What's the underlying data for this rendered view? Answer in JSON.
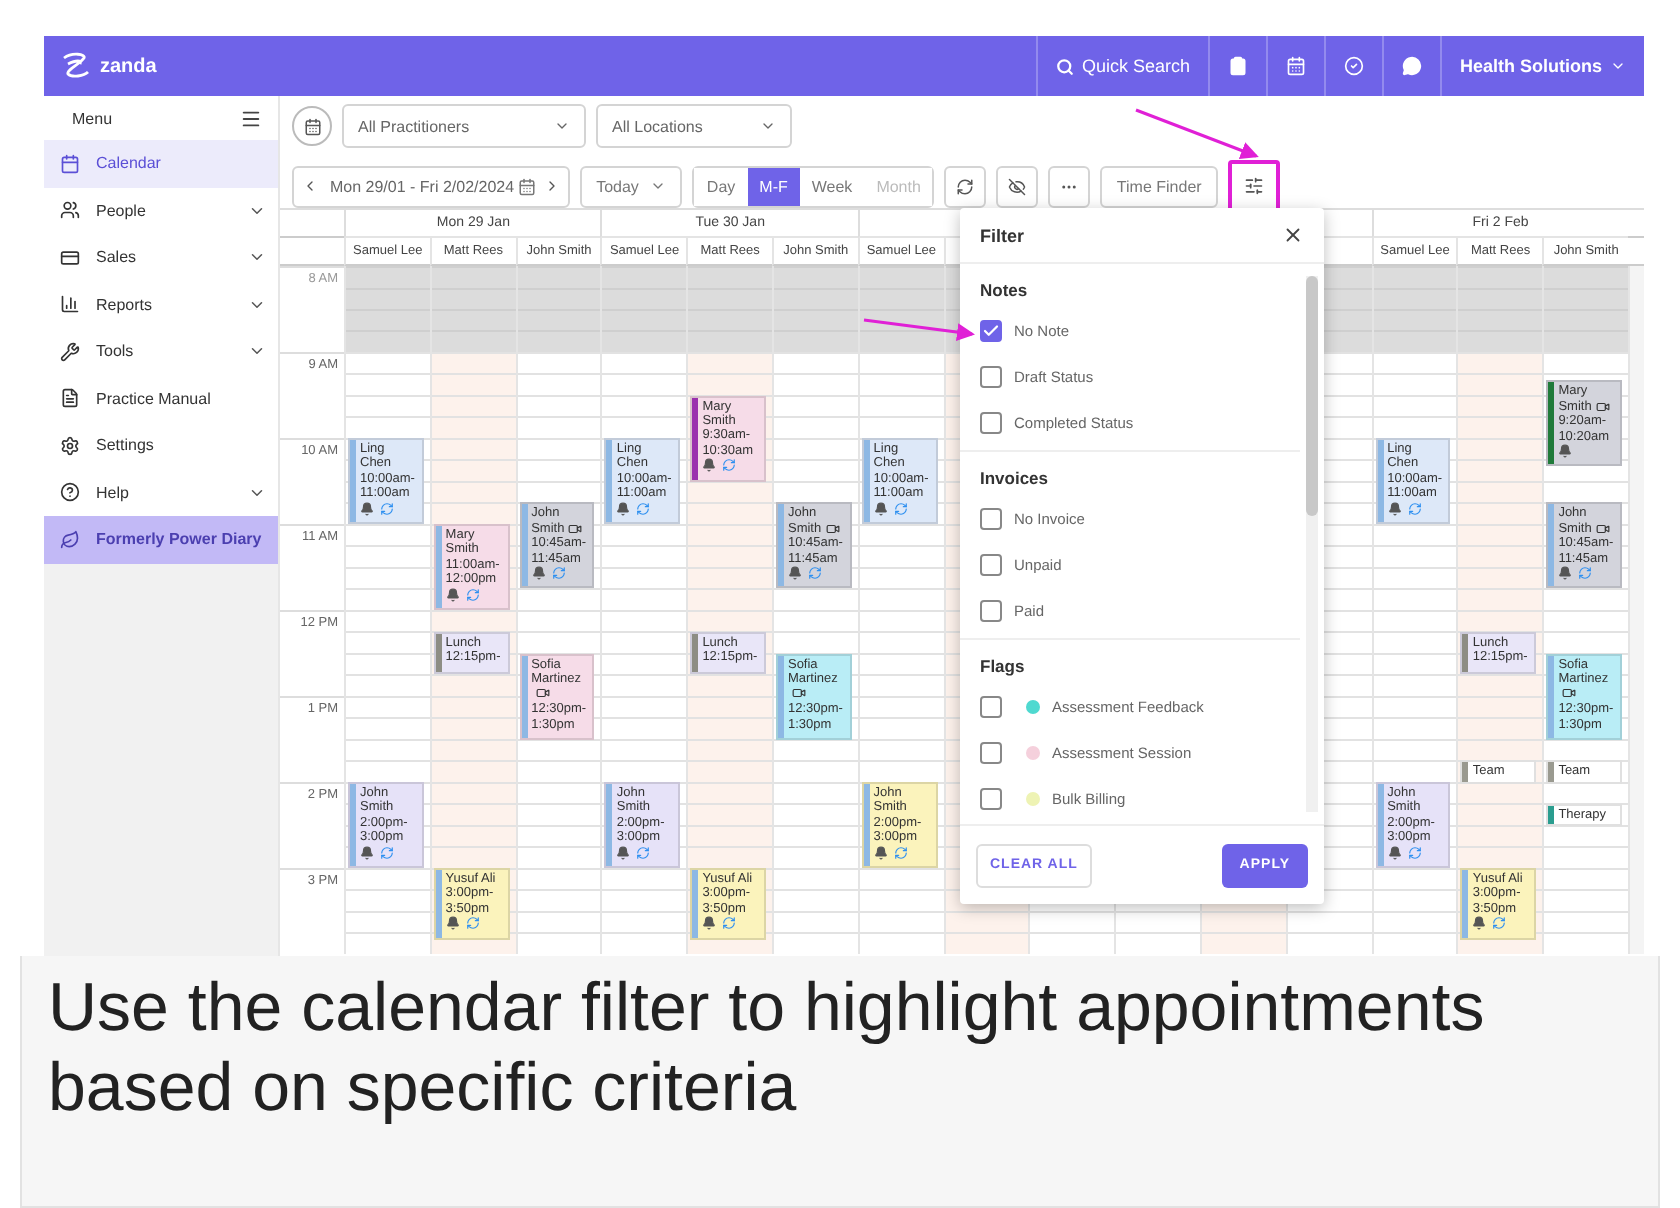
{
  "topbar": {
    "logo": "zanda",
    "search": "Quick Search",
    "account": "Health Solutions"
  },
  "sidebar": {
    "title": "Menu",
    "items": [
      {
        "label": "Calendar",
        "selected": true,
        "expandable": false,
        "kind": "nav"
      },
      {
        "label": "People",
        "selected": false,
        "expandable": true,
        "kind": "nav"
      },
      {
        "label": "Sales",
        "selected": false,
        "expandable": true,
        "kind": "nav"
      },
      {
        "label": "Reports",
        "selected": false,
        "expandable": true,
        "kind": "nav"
      },
      {
        "label": "Tools",
        "selected": false,
        "expandable": true,
        "kind": "nav"
      },
      {
        "label": "Practice Manual",
        "selected": false,
        "expandable": false,
        "kind": "nav"
      },
      {
        "label": "Settings",
        "selected": false,
        "expandable": false,
        "kind": "nav"
      },
      {
        "label": "Help",
        "selected": false,
        "expandable": true,
        "kind": "nav"
      },
      {
        "label": "Formerly Power Diary",
        "selected": false,
        "expandable": false,
        "kind": "banner"
      }
    ]
  },
  "toolbar": {
    "practitioners": "All Practitioners",
    "locations": "All Locations",
    "date_range": "Mon 29/01 - Fri 2/02/2024",
    "today": "Today",
    "views": [
      {
        "label": "Day",
        "selected": false,
        "disabled": false
      },
      {
        "label": "M-F",
        "selected": true,
        "disabled": false
      },
      {
        "label": "Week",
        "selected": false,
        "disabled": false
      },
      {
        "label": "Month",
        "selected": false,
        "disabled": true
      }
    ],
    "time_finder": "Time Finder",
    "filter_highlighted": true
  },
  "calendar": {
    "hours": [
      {
        "label": "8 AM",
        "closed": true
      },
      {
        "label": "9 AM",
        "closed": false
      },
      {
        "label": "10 AM",
        "closed": false
      },
      {
        "label": "11 AM",
        "closed": false
      },
      {
        "label": "12 PM",
        "closed": false
      },
      {
        "label": "1 PM",
        "closed": false
      },
      {
        "label": "2 PM",
        "closed": false
      },
      {
        "label": "3 PM",
        "closed": false
      }
    ],
    "days": [
      {
        "label": "Mon 29 Jan",
        "columns": [
          {
            "name": "Samuel Lee",
            "shaded": false,
            "appointments": [
              {
                "title": "Ling Chen",
                "time": "10:00am-11:00am",
                "color": "#dde8f8",
                "stripe": {
                  "color": "#8db8e4"
                },
                "video": false,
                "reminder": true,
                "recurring": true
              },
              {
                "title": "John Smith",
                "time": "2:00pm-3:00pm",
                "color": "#e6e2f8",
                "stripe": {
                  "color": "#8db8e4"
                },
                "video": false,
                "reminder": true,
                "recurring": true
              }
            ]
          },
          {
            "name": "Matt Rees",
            "shaded": true,
            "appointments": [
              {
                "title": "Mary Smith",
                "time": "11:00am-12:00pm",
                "color": "#f6dce8",
                "stripe": {
                  "color": "#8db8e4"
                },
                "video": false,
                "reminder": true,
                "recurring": true
              },
              {
                "title": "Lunch",
                "time": "12:15pm-",
                "color": "#e9e6f8",
                "stripe": {
                  "color": "#8d8d84"
                },
                "video": false,
                "reminder": false,
                "recurring": false
              },
              {
                "title": "Yusuf Ali",
                "time": "3:00pm-3:50pm",
                "color": "#fbf3bc",
                "stripe": {
                  "color": "#8db8e4"
                },
                "video": false,
                "reminder": true,
                "recurring": true
              }
            ]
          },
          {
            "name": "John Smith",
            "shaded": false,
            "appointments": [
              {
                "title": "John Smith",
                "time": "10:45am-11:45am",
                "color": "#d3d4dc",
                "stripe": {
                  "color": "#8db8e4"
                },
                "video": true,
                "reminder": true,
                "recurring": true
              },
              {
                "title": "Sofia Martinez",
                "time": "12:30pm-1:30pm",
                "color": "#f6dce8",
                "stripe": {
                  "color": "#8db8e4"
                },
                "video": true,
                "reminder": false,
                "recurring": false
              }
            ]
          }
        ]
      },
      {
        "label": "Tue 30 Jan",
        "columns": [
          {
            "name": "Samuel Lee",
            "shaded": false,
            "appointments": [
              {
                "title": "Ling Chen",
                "time": "10:00am-11:00am",
                "color": "#dde8f8",
                "stripe": {
                  "color": "#8db8e4"
                },
                "video": false,
                "reminder": true,
                "recurring": true
              },
              {
                "title": "John Smith",
                "time": "2:00pm-3:00pm",
                "color": "#e6e2f8",
                "stripe": {
                  "color": "#8db8e4"
                },
                "video": false,
                "reminder": true,
                "recurring": true
              }
            ]
          },
          {
            "name": "Matt Rees",
            "shaded": true,
            "appointments": [
              {
                "title": "Mary Smith",
                "time": "9:30am-10:30am",
                "color": "#f6dce8",
                "stripe": {
                  "color": "#9b2fae"
                },
                "video": false,
                "reminder": true,
                "recurring": true
              },
              {
                "title": "Lunch",
                "time": "12:15pm-",
                "color": "#e9e6f8",
                "stripe": {
                  "color": "#8d8d84"
                },
                "video": false,
                "reminder": false,
                "recurring": false
              },
              {
                "title": "Yusuf Ali",
                "time": "3:00pm-3:50pm",
                "color": "#fbf3bc",
                "stripe": {
                  "color": "#8db8e4"
                },
                "video": false,
                "reminder": true,
                "recurring": true
              }
            ]
          },
          {
            "name": "John Smith",
            "shaded": false,
            "appointments": [
              {
                "title": "John Smith",
                "time": "10:45am-11:45am",
                "color": "#d3d4dc",
                "stripe": {
                  "color": "#8db8e4"
                },
                "video": true,
                "reminder": true,
                "recurring": true
              },
              {
                "title": "Sofia Martinez",
                "time": "12:30pm-1:30pm",
                "color": "#b9edf6",
                "stripe": {
                  "color": "#8db8e4"
                },
                "video": true,
                "reminder": false,
                "recurring": false
              }
            ]
          }
        ]
      },
      {
        "columns": [
          {
            "name": "Samuel Lee",
            "shaded": false,
            "appointments": [
              {
                "title": "Ling Chen",
                "time": "10:00am-11:00am",
                "color": "#dde8f8",
                "stripe": {
                  "color": "#8db8e4"
                },
                "video": false,
                "reminder": true,
                "recurring": true
              },
              {
                "title": "John Smith",
                "time": "2:00pm-3:00pm",
                "color": "#fbf3bc",
                "stripe": {
                  "color": "#8db8e4"
                },
                "video": false,
                "reminder": true,
                "recurring": true
              }
            ]
          },
          {
            "shaded": true
          },
          {
            "shaded": false
          }
        ]
      },
      {
        "columns": [
          {
            "shaded": false
          },
          {
            "shaded": true
          },
          {
            "shaded": false
          }
        ]
      },
      {
        "label": "Fri 2 Feb",
        "columns": [
          {
            "name": "Samuel Lee",
            "shaded": false,
            "appointments": [
              {
                "title": "Ling Chen",
                "time": "10:00am-11:00am",
                "color": "#dde8f8",
                "stripe": {
                  "color": "#8db8e4"
                },
                "video": false,
                "reminder": true,
                "recurring": true
              },
              {
                "title": "John Smith",
                "time": "2:00pm-3:00pm",
                "color": "#e6e2f8",
                "stripe": {
                  "color": "#8db8e4"
                },
                "video": false,
                "reminder": true,
                "recurring": true
              }
            ]
          },
          {
            "name": "Matt Rees",
            "shaded": true,
            "appointments": [
              {
                "title": "Lunch",
                "time": "12:15pm-",
                "color": "#e9e6f8",
                "stripe": {
                  "color": "#8d8d84"
                },
                "video": false,
                "reminder": false,
                "recurring": false
              },
              {
                "title": "Team",
                "color": "#ffffff",
                "stripe": {
                  "color": "#9a9a90"
                },
                "video": false,
                "reminder": false,
                "recurring": false
              },
              {
                "title": "Yusuf Ali",
                "time": "3:00pm-3:50pm",
                "color": "#fbf3bc",
                "stripe": {
                  "color": "#8db8e4"
                },
                "video": false,
                "reminder": true,
                "recurring": true
              }
            ]
          },
          {
            "name": "John Smith",
            "shaded": false,
            "appointments": [
              {
                "title": "Mary Smith",
                "time": "9:20am-10:20am",
                "color": "#d3d4dc",
                "stripe": {
                  "color": "#1f7a3a"
                },
                "video": true,
                "reminder": true,
                "recurring": false
              },
              {
                "title": "John Smith",
                "time": "10:45am-11:45am",
                "color": "#d3d4dc",
                "stripe": {
                  "color": "#8db8e4"
                },
                "video": true,
                "reminder": true,
                "recurring": true
              },
              {
                "title": "Sofia Martinez",
                "time": "12:30pm-1:30pm",
                "color": "#b9edf6",
                "stripe": {
                  "color": "#8db8e4"
                },
                "video": true,
                "reminder": false,
                "recurring": false
              },
              {
                "title": "Team",
                "color": "#ffffff",
                "stripe": {
                  "color": "#9a9a90"
                },
                "video": false,
                "reminder": false,
                "recurring": false
              },
              {
                "title": "Therapy",
                "color": "#ffffff",
                "stripe": {
                  "color": "#2a9d8f"
                },
                "video": false,
                "reminder": false,
                "recurring": false
              }
            ]
          }
        ]
      }
    ]
  },
  "filter": {
    "title": "Filter",
    "sections": [
      {
        "title": "Notes",
        "options": [
          {
            "label": "No Note",
            "checked": true
          },
          {
            "label": "Draft Status",
            "checked": false
          },
          {
            "label": "Completed Status",
            "checked": false
          }
        ]
      },
      {
        "title": "Invoices",
        "options": [
          {
            "label": "No Invoice",
            "checked": false
          },
          {
            "label": "Unpaid",
            "checked": false
          },
          {
            "label": "Paid",
            "checked": false
          }
        ]
      },
      {
        "title": "Flags",
        "options": [
          {
            "label": "Assessment Feedback",
            "checked": false,
            "color": "#4fd9d0"
          },
          {
            "label": "Assessment Session",
            "checked": false,
            "color": "#f5d0dc"
          },
          {
            "label": "Bulk Billing",
            "checked": false,
            "color": "#eef3b4"
          }
        ]
      }
    ],
    "clear": "CLEAR ALL",
    "apply": "APPLY"
  },
  "caption": "Use the calendar filter to highlight appointments based on specific criteria"
}
